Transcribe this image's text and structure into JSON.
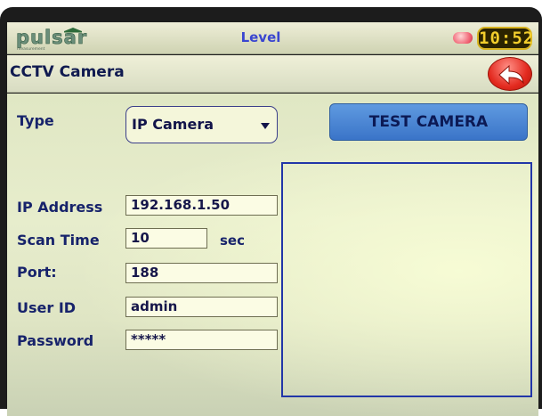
{
  "header": {
    "logo_text": "pulsar",
    "logo_tagline": "measurement",
    "title": "Level",
    "clock": "10:52"
  },
  "page": {
    "title": "CCTV Camera"
  },
  "form": {
    "type": {
      "label": "Type",
      "value": "IP Camera"
    },
    "ip_address": {
      "label": "IP Address",
      "value": "192.168.1.50"
    },
    "scan_time": {
      "label": "Scan Time",
      "value": "10",
      "unit": "sec"
    },
    "port": {
      "label": "Port:",
      "value": "188"
    },
    "user_id": {
      "label": "User ID",
      "value": "admin"
    },
    "password": {
      "label": "Password",
      "value": "*****"
    }
  },
  "actions": {
    "test_camera": "TEST CAMERA"
  },
  "icons": {
    "back": "back-arrow-icon",
    "status": "status-led-icon"
  },
  "colors": {
    "title_blue": "#3a46d0",
    "label_navy": "#17236b",
    "button_blue": "#4a85d4",
    "back_red": "#e32a1f",
    "preview_border": "#2236a8",
    "clock_amber": "#f2cd2c"
  }
}
